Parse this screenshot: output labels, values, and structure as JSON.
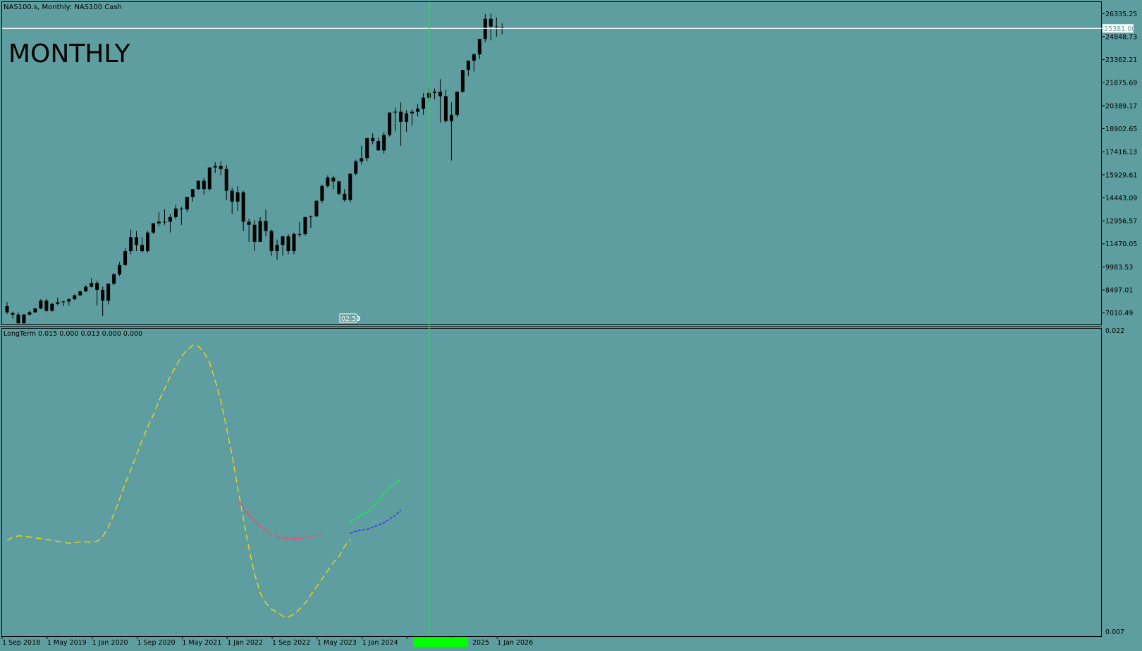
{
  "header": {
    "symbol_label": "NAS100.s, Monthly:  NAS100 Cash",
    "watermark": "MONTHLY"
  },
  "price_axis": {
    "ticks": [
      "26335.25",
      "24848.73",
      "23362.21",
      "21875.69",
      "20389.17",
      "18902.65",
      "17416.13",
      "15929.61",
      "14443.09",
      "12956.57",
      "11470.05",
      "9983.53",
      "8497.01",
      "7010.49"
    ],
    "current_price": "25381.00"
  },
  "countdown": "02:50",
  "indicator": {
    "label": "LongTerm 0.015 0.000 0.013 0.000 0.000",
    "ymax_label": "0.022",
    "ymin_label": "0.007"
  },
  "time_axis": {
    "labels": [
      "1 Sep 2018",
      "1 May 2019",
      "1 Jan 2020",
      "1 Sep 2020",
      "1 May 2021",
      "1 Jan 2022",
      "1 Sep 2022",
      "1 May 2023",
      "1 Jan 2024",
      "",
      "2025",
      "1 Jan 2026"
    ]
  },
  "colors": {
    "background": "#5f9ea0",
    "candle": "#000000",
    "grid_border": "#000000",
    "price_line": "#ffffff",
    "cursor_line": "#00ff00",
    "series_yellow": "#ffd700",
    "series_red": "#ff3f6f",
    "series_green": "#00ff40",
    "series_blue": "#3a3ad0"
  },
  "chart_data": [
    {
      "type": "candlestick",
      "title": "NAS100.s, Monthly:  NAS100 Cash",
      "x_start": "2018-09",
      "x_step": "1 month",
      "ylim": [
        6267,
        27078
      ],
      "ohlc": [
        [
          7450,
          7720,
          6950,
          7050
        ],
        [
          7000,
          7100,
          6650,
          6900
        ],
        [
          6900,
          7050,
          6320,
          6350
        ],
        [
          6350,
          6950,
          6300,
          6900
        ],
        [
          6900,
          7150,
          6850,
          7050
        ],
        [
          7050,
          7300,
          7000,
          7300
        ],
        [
          7300,
          7900,
          7250,
          7800
        ],
        [
          7800,
          7920,
          7050,
          7150
        ],
        [
          7150,
          7650,
          7100,
          7600
        ],
        [
          7600,
          8000,
          7500,
          7700
        ],
        [
          7700,
          7800,
          7450,
          7750
        ],
        [
          7750,
          7950,
          7500,
          7900
        ],
        [
          7900,
          8200,
          7850,
          8150
        ],
        [
          8150,
          8450,
          8100,
          8400
        ],
        [
          8400,
          8800,
          8350,
          8700
        ],
        [
          8700,
          9250,
          8650,
          8950
        ],
        [
          8950,
          9100,
          7500,
          8500
        ],
        [
          8500,
          8700,
          6800,
          7800
        ],
        [
          7800,
          8900,
          7550,
          8900
        ],
        [
          8900,
          9600,
          8800,
          9500
        ],
        [
          9500,
          10300,
          9400,
          10100
        ],
        [
          10100,
          11200,
          10050,
          11000
        ],
        [
          11000,
          12400,
          10800,
          11900
        ],
        [
          11900,
          12300,
          11000,
          11400
        ],
        [
          11400,
          11900,
          10900,
          11000
        ],
        [
          11000,
          12300,
          10900,
          12200
        ],
        [
          12200,
          12800,
          12100,
          12800
        ],
        [
          12800,
          13500,
          12600,
          12900
        ],
        [
          12900,
          13700,
          12700,
          12900
        ],
        [
          12900,
          13400,
          12200,
          13200
        ],
        [
          13200,
          14000,
          13050,
          13750
        ],
        [
          13750,
          13850,
          12700,
          13700
        ],
        [
          13700,
          14200,
          13500,
          14500
        ],
        [
          14500,
          15000,
          14200,
          15000
        ],
        [
          15000,
          15500,
          14950,
          15550
        ],
        [
          15550,
          15750,
          14650,
          15000
        ],
        [
          15000,
          16100,
          14900,
          16400
        ],
        [
          16400,
          16750,
          16050,
          16500
        ],
        [
          16500,
          16800,
          15900,
          16300
        ],
        [
          16300,
          16550,
          14300,
          14900
        ],
        [
          14900,
          15100,
          13400,
          14200
        ],
        [
          14200,
          15200,
          13600,
          14800
        ],
        [
          14800,
          14900,
          12300,
          12900
        ],
        [
          12900,
          13100,
          11600,
          12700
        ],
        [
          12700,
          13000,
          11000,
          11600
        ],
        [
          11600,
          13200,
          11600,
          12950
        ],
        [
          12950,
          13700,
          11950,
          12300
        ],
        [
          12300,
          12400,
          10700,
          11000
        ],
        [
          11000,
          11750,
          10450,
          11400
        ],
        [
          11400,
          12000,
          10700,
          11950
        ],
        [
          11950,
          12100,
          10800,
          11000
        ],
        [
          11000,
          12200,
          10800,
          12100
        ],
        [
          12100,
          12900,
          11900,
          12100
        ],
        [
          12100,
          13200,
          12000,
          13200
        ],
        [
          13200,
          13300,
          12500,
          13250
        ],
        [
          13250,
          14300,
          13200,
          14250
        ],
        [
          14250,
          15300,
          14100,
          15200
        ],
        [
          15200,
          15900,
          15100,
          15750
        ],
        [
          15750,
          15850,
          15000,
          15500
        ],
        [
          15500,
          15550,
          14600,
          14700
        ],
        [
          14700,
          15000,
          14200,
          14300
        ],
        [
          14300,
          16000,
          14150,
          16000
        ],
        [
          16000,
          16900,
          15900,
          16800
        ],
        [
          16800,
          17800,
          16600,
          17000
        ],
        [
          17000,
          17700,
          16800,
          18300
        ],
        [
          18300,
          18600,
          17900,
          18100
        ],
        [
          18100,
          18350,
          17600,
          17500
        ],
        [
          17500,
          18700,
          17300,
          18500
        ],
        [
          18500,
          19700,
          18400,
          19950
        ],
        [
          19950,
          20250,
          18750,
          20000
        ],
        [
          20000,
          20600,
          17800,
          19350
        ],
        [
          19350,
          20100,
          18700,
          19900
        ],
        [
          19900,
          20150,
          19100,
          20000
        ],
        [
          20000,
          20500,
          19700,
          20200
        ],
        [
          20200,
          21200,
          19800,
          20900
        ],
        [
          20900,
          21600,
          20600,
          21200
        ],
        [
          21200,
          21500,
          20800,
          21300
        ],
        [
          21300,
          22100,
          19300,
          21000
        ],
        [
          21000,
          21400,
          19300,
          19400
        ],
        [
          19400,
          20600,
          16850,
          19800
        ],
        [
          19800,
          21300,
          19650,
          21300
        ],
        [
          21300,
          22400,
          21200,
          22700
        ],
        [
          22700,
          23300,
          22300,
          23300
        ],
        [
          23300,
          23800,
          22600,
          23700
        ],
        [
          23700,
          24700,
          23400,
          24700
        ],
        [
          24700,
          26300,
          24500,
          26000
        ],
        [
          26000,
          26335,
          24600,
          25500
        ],
        [
          25500,
          26100,
          24850,
          25500
        ],
        [
          25450,
          25700,
          25000,
          25381
        ]
      ],
      "current_price": 25381.0
    },
    {
      "type": "line",
      "title": "LongTerm 0.015 0.000 0.013 0.000 0.000",
      "ylim": [
        0.007,
        0.022
      ],
      "x_axis": "same months as candlestick",
      "series": [
        {
          "color": "#ffd700",
          "start_index": 0,
          "values": [
            0.0116,
            0.01175,
            0.01182,
            0.01181,
            0.01177,
            0.01172,
            0.01168,
            0.01164,
            0.0116,
            0.01155,
            0.0115,
            0.01146,
            0.01148,
            0.01152,
            0.01153,
            0.01151,
            0.01156,
            0.0118,
            0.01225,
            0.0129,
            0.01365,
            0.0144,
            0.0151,
            0.0158,
            0.01655,
            0.0172,
            0.0178,
            0.0185,
            0.0191,
            0.0197,
            0.0202,
            0.0207,
            0.021,
            0.02125,
            0.0212,
            0.0209,
            0.0204,
            0.0195,
            0.0185,
            0.0172,
            0.0158,
            0.0142,
            0.0127,
            0.0112,
            0.00995,
            0.009,
            0.0085,
            0.0082,
            0.00805,
            0.00785,
            0.00781,
            0.00795,
            0.0082,
            0.0085,
            0.0089,
            0.0093,
            0.0097,
            0.0101,
            0.0105,
            0.0108,
            0.0113,
            0.01165
          ]
        },
        {
          "color": "#ff3f6f",
          "start_index": 41,
          "values": [
            0.0136,
            0.0132,
            0.01285,
            0.0126,
            0.0123,
            0.0121,
            0.0119,
            0.0118,
            0.0117,
            0.01168,
            0.01167,
            0.0117,
            0.01175,
            0.0118,
            0.01186,
            0.01195
          ]
        },
        {
          "color": "#00ff40",
          "start_index": 61,
          "values": [
            0.0125,
            0.0127,
            0.01285,
            0.013,
            0.01325,
            0.01355,
            0.0139,
            0.0142,
            0.0144,
            0.01465
          ]
        },
        {
          "color": "#3a3ad0",
          "start_index": 61,
          "values": [
            0.01195,
            0.01205,
            0.0121,
            0.01215,
            0.01225,
            0.01235,
            0.01248,
            0.01265,
            0.01283,
            0.0131
          ]
        }
      ]
    }
  ]
}
